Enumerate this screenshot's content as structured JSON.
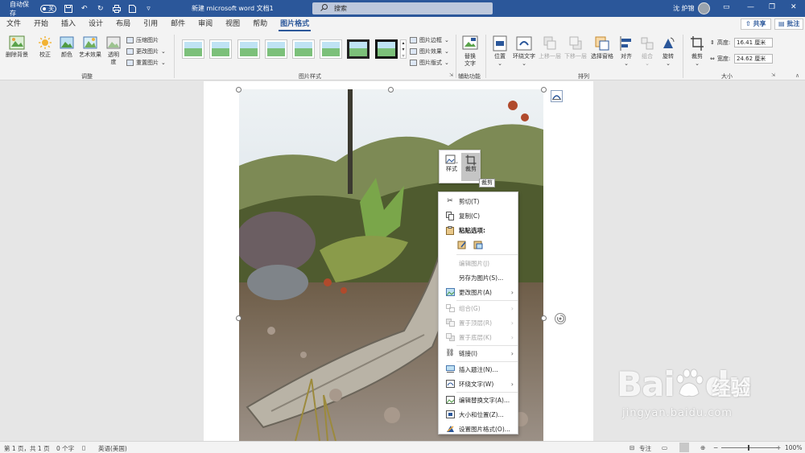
{
  "titlebar": {
    "autosave_label": "自动保存",
    "autosave_state": "关",
    "doc_title": "新建 microsoft word 文档1",
    "search_placeholder": "搜索",
    "user_name": "沈 炉锦"
  },
  "tabs": [
    {
      "label": "文件"
    },
    {
      "label": "开始"
    },
    {
      "label": "插入"
    },
    {
      "label": "设计"
    },
    {
      "label": "布局"
    },
    {
      "label": "引用"
    },
    {
      "label": "邮件"
    },
    {
      "label": "审阅"
    },
    {
      "label": "视图"
    },
    {
      "label": "帮助"
    },
    {
      "label": "图片格式"
    }
  ],
  "share_label": "共享",
  "comment_label": "批注",
  "ribbon": {
    "adjust": {
      "remove_bg": "删除背景",
      "corrections": "校正",
      "color": "颜色",
      "artistic": "艺术效果",
      "transparency_1": "透明",
      "transparency_2": "度",
      "compress": "压缩图片",
      "change": "更改图片",
      "reset": "重置图片",
      "group_label": "调整"
    },
    "styles": {
      "border": "图片边框",
      "effects": "图片效果",
      "layout": "图片版式",
      "group_label": "图片样式"
    },
    "accessibility": {
      "alt_text_1": "替换",
      "alt_text_2": "文字",
      "group_label": "辅助功能"
    },
    "arrange": {
      "position": "位置",
      "wrap_text": "环绕文字",
      "bring_forward": "上移一层",
      "send_backward": "下移一层",
      "selection_pane": "选择窗格",
      "align": "对齐",
      "group": "组合",
      "rotate": "旋转",
      "group_label": "排列"
    },
    "size": {
      "crop": "裁剪",
      "height_label": "高度:",
      "height_value": "16.41 厘米",
      "width_label": "宽度:",
      "width_value": "24.62 厘米",
      "group_label": "大小"
    }
  },
  "mini_toolbar": {
    "style_label": "样式",
    "crop_label": "裁剪",
    "tooltip": "裁剪"
  },
  "context_menu": {
    "cut": "剪切(T)",
    "copy": "复制(C)",
    "paste_options": "粘贴选项:",
    "edit_picture": "编辑图片(J)",
    "save_as_picture": "另存为图片(S)...",
    "change_picture": "更改图片(A)",
    "group": "组合(G)",
    "bring_to_front": "置于顶层(R)",
    "send_to_back": "置于底层(K)",
    "link": "链接(I)",
    "insert_caption": "插入题注(N)...",
    "wrap_text": "环绕文字(W)",
    "edit_alt_text": "编辑替换文字(A)...",
    "size_position": "大小和位置(Z)...",
    "format_picture": "设置图片格式(O)..."
  },
  "statusbar": {
    "page": "第 1 页，共 1 页",
    "words": "0 个字",
    "language": "英语(美国)",
    "focus": "专注",
    "zoom": "100%"
  },
  "watermark": {
    "brand": "Bai",
    "brand_tail": "du",
    "cn": "经验",
    "url": "jingyan.baidu.com"
  },
  "colors": {
    "accent": "#2b579a",
    "ribbon_bg": "#f3f3f3",
    "canvas_bg": "#e6e6e6"
  }
}
